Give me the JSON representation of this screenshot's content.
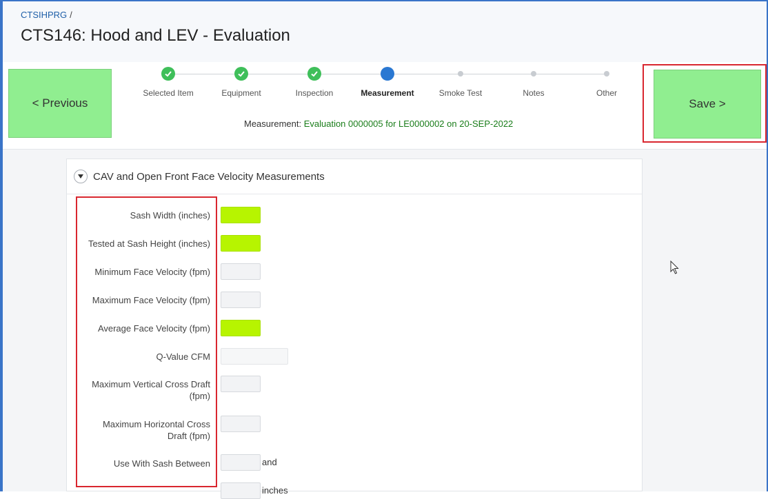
{
  "header": {
    "breadcrumb": "CTSIHPRG",
    "breadcrumb_sep": "/",
    "title": "CTS146: Hood and LEV - Evaluation"
  },
  "wizard": {
    "prev_label": "< Previous",
    "save_label": "Save >",
    "steps": [
      {
        "label": "Selected Item",
        "state": "done"
      },
      {
        "label": "Equipment",
        "state": "done"
      },
      {
        "label": "Inspection",
        "state": "done"
      },
      {
        "label": "Measurement",
        "state": "current"
      },
      {
        "label": "Smoke Test",
        "state": "todo"
      },
      {
        "label": "Notes",
        "state": "todo"
      },
      {
        "label": "Other",
        "state": "todo"
      }
    ],
    "message_prefix": "Measurement: ",
    "message_link": "Evaluation 0000005 for LE0000002 on 20-SEP-2022"
  },
  "region": {
    "title": "CAV and Open Front Face Velocity Measurements",
    "fields": {
      "sash_width": "Sash Width (inches)",
      "sash_height": "Tested at Sash Height (inches)",
      "min_face_velocity": "Minimum Face Velocity (fpm)",
      "max_face_velocity": "Maximum Face Velocity (fpm)",
      "avg_face_velocity": "Average Face Velocity (fpm)",
      "q_value": "Q-Value CFM",
      "max_vertical_line1": "Maximum Vertical Cross Draft",
      "max_vertical_line2": "(fpm)",
      "max_horizontal_line1": "Maximum Horizontal Cross",
      "max_horizontal_line2": "Draft (fpm)",
      "sash_between": "Use With Sash Between"
    },
    "and_label": "and",
    "inches_label": "inches"
  },
  "colors": {
    "accent_green": "#90ee90",
    "required_field": "#b7f400",
    "highlight_red": "#d9262e",
    "step_done": "#3fbf5a",
    "step_current": "#2a78d2"
  }
}
